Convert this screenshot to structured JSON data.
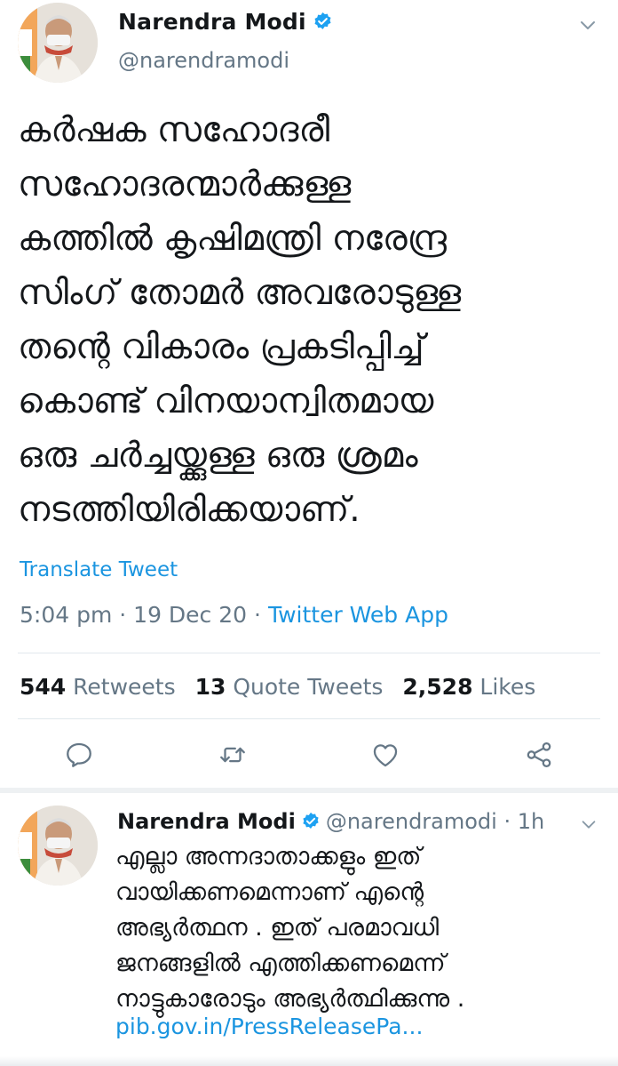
{
  "main_tweet": {
    "author_name": "Narendra Modi",
    "handle": "@narendramodi",
    "text_lines": [
      "കർഷക സഹോദരീ",
      "സഹോദരന്മാർക്കുള്ള",
      "കത്തിൽ  കൃഷിമന്ത്രി നരേന്ദ്ര",
      "സിംഗ് തോമർ അവരോടുള്ള",
      "തന്റെ വികാരം പ്രകടിപ്പിച്ച്",
      "കൊണ്ട് വിനയാന്വിതമായ",
      "ഒരു ചർച്ചയ്ക്കുള്ള ഒരു ശ്രമം",
      "നടത്തിയിരിക്കയാണ്."
    ],
    "translate_label": "Translate Tweet",
    "time": "5:04 pm",
    "date": "19 Dec 20",
    "source": "Twitter Web App",
    "stats": {
      "retweets_count": "544",
      "retweets_label": "Retweets",
      "quotes_count": "13",
      "quotes_label": "Quote Tweets",
      "likes_count": "2,528",
      "likes_label": "Likes"
    }
  },
  "reply_tweet": {
    "author_name": "Narendra Modi",
    "handle": "@narendramodi",
    "time_ago": "1h",
    "text_lines": [
      "എല്ലാ അന്നദാതാക്കളും ഇത്",
      "വായിക്കണമെന്നാണ് എന്റെ",
      "അഭ്യർത്ഥന . ഇത് പരമാവധി",
      "ജനങ്ങളിൽ എത്തിക്കണമെന്ന്",
      "നാട്ടുകാരോടും അഭ്യർത്ഥിക്കുന്നു ."
    ],
    "link_text": "pib.gov.in/PressReleasePa..."
  },
  "colors": {
    "accent": "#1da1f2",
    "link": "#1b95e0",
    "secondary_text": "#657786",
    "divider": "#e1e8ed"
  },
  "icons": [
    "verified-badge-icon",
    "chevron-down-icon",
    "reply-icon",
    "retweet-icon",
    "like-icon",
    "share-icon"
  ]
}
